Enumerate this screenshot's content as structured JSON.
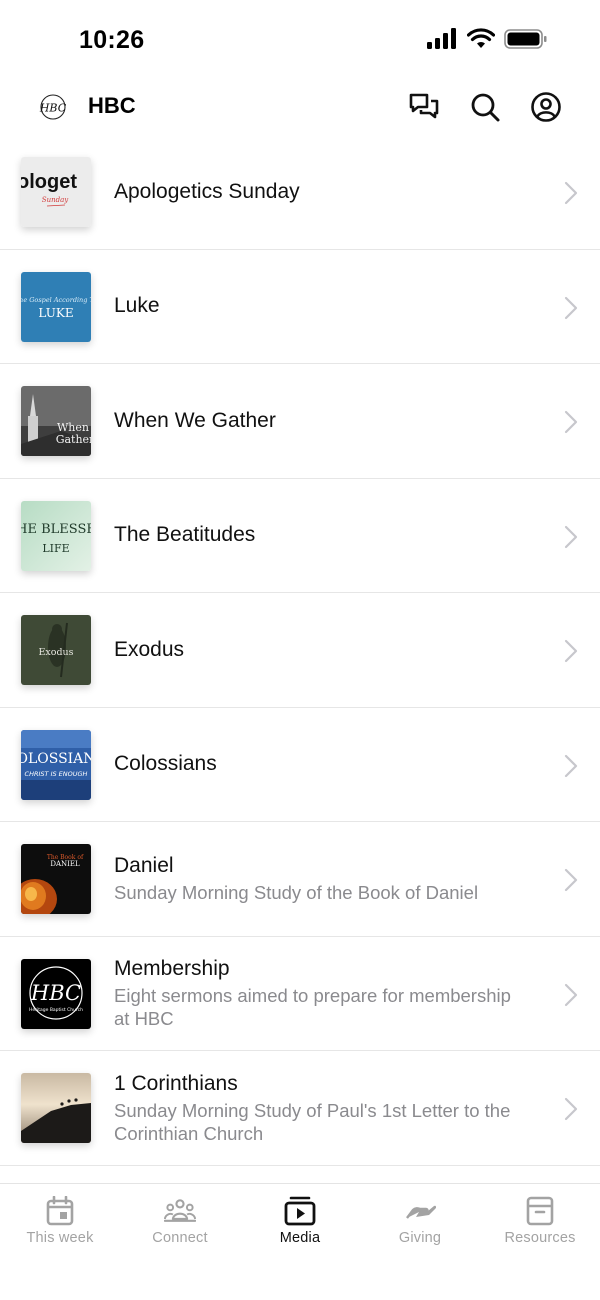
{
  "status_bar": {
    "time": "10:26"
  },
  "header": {
    "title": "HBC",
    "logo_text": "HBC",
    "icons": [
      "chat-icon",
      "search-icon",
      "account-icon"
    ]
  },
  "series": [
    {
      "title": "Apologetics Sunday",
      "subtitle": "",
      "thumb_text": "ologet",
      "thumb_text2": "Sunday"
    },
    {
      "title": "Luke",
      "subtitle": "",
      "thumb_text": "The Gospel According To",
      "thumb_text2": "LUKE"
    },
    {
      "title": "When We Gather",
      "subtitle": "",
      "thumb_text": "When",
      "thumb_text2": "Gather"
    },
    {
      "title": "The Beatitudes",
      "subtitle": "",
      "thumb_text": "HE BLESSE",
      "thumb_text2": "LIFE"
    },
    {
      "title": "Exodus",
      "subtitle": "",
      "thumb_text": "Exodus",
      "thumb_text2": ""
    },
    {
      "title": "Colossians",
      "subtitle": "",
      "thumb_text": "OLOSSIAN",
      "thumb_text2": "CHRIST IS ENOUGH"
    },
    {
      "title": "Daniel",
      "subtitle": "Sunday Morning Study of the Book of Daniel",
      "thumb_text": "The Book of",
      "thumb_text2": "DANIEL"
    },
    {
      "title": "Membership",
      "subtitle": "Eight sermons aimed to prepare for membership at HBC",
      "thumb_text": "HBC",
      "thumb_text2": "Heritage Baptist Church"
    },
    {
      "title": "1 Corinthians",
      "subtitle": "Sunday Morning Study of Paul's 1st Letter to the Corinthian Church",
      "thumb_text": "",
      "thumb_text2": ""
    }
  ],
  "tabs": [
    {
      "label": "This week",
      "icon": "calendar-icon",
      "active": false
    },
    {
      "label": "Connect",
      "icon": "people-icon",
      "active": false
    },
    {
      "label": "Media",
      "icon": "media-icon",
      "active": true
    },
    {
      "label": "Giving",
      "icon": "giving-hand-icon",
      "active": false
    },
    {
      "label": "Resources",
      "icon": "archive-box-icon",
      "active": false
    }
  ],
  "colors": {
    "active_tab": "#111111",
    "inactive_tab": "#a3a3a3",
    "subtitle": "#8a8a8e",
    "divider": "#e6e6e6"
  }
}
